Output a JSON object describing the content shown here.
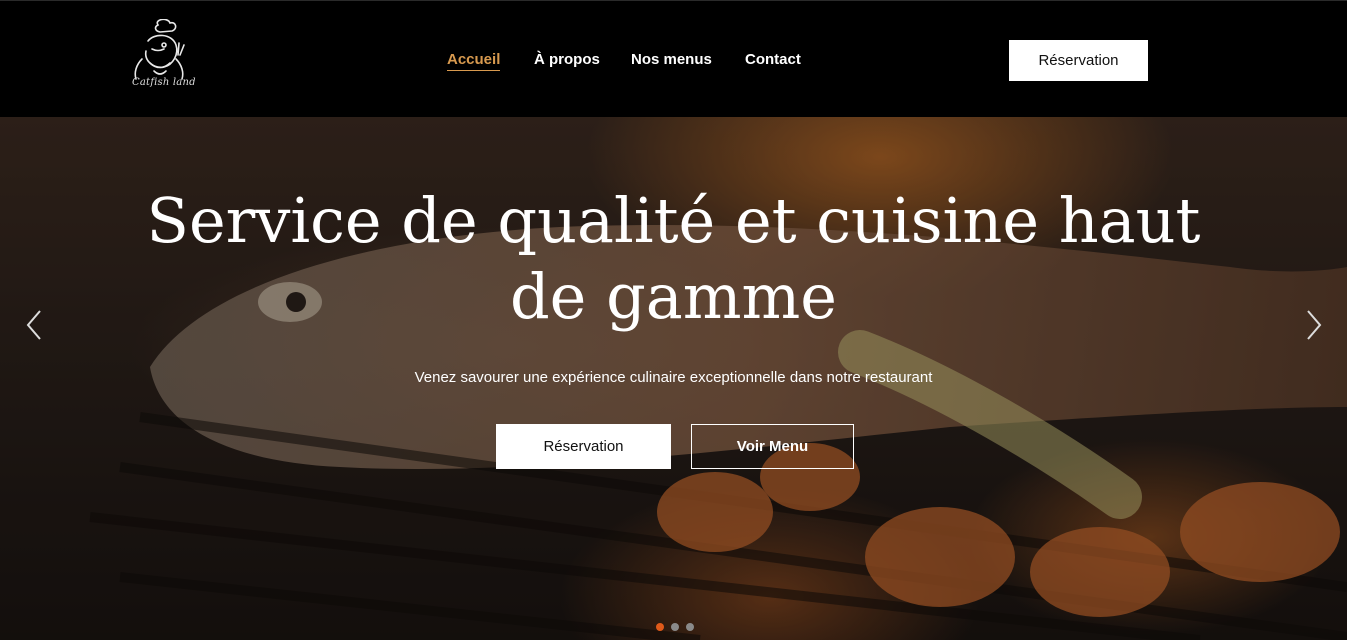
{
  "header": {
    "logo_text": "Catfish land",
    "nav": [
      {
        "label": "Accueil",
        "active": true
      },
      {
        "label": "À propos",
        "active": false
      },
      {
        "label": "Nos menus",
        "active": false
      },
      {
        "label": "Contact",
        "active": false
      }
    ],
    "reserve_label": "Réservation"
  },
  "hero": {
    "title_line1": "Service de qualité et cuisine haut",
    "title_line2": "de gamme",
    "subtitle": "Venez savourer une expérience culinaire exceptionnelle dans notre restaurant",
    "primary_button": "Réservation",
    "secondary_button": "Voir Menu",
    "slides": {
      "count": 3,
      "active_index": 0
    }
  },
  "colors": {
    "accent": "#d89a4f",
    "dot_active": "#e05a1a",
    "header_bg": "#000000"
  },
  "icons": {
    "prev": "chevron-left-icon",
    "next": "chevron-right-icon",
    "logo": "chef-catfish-logo"
  }
}
